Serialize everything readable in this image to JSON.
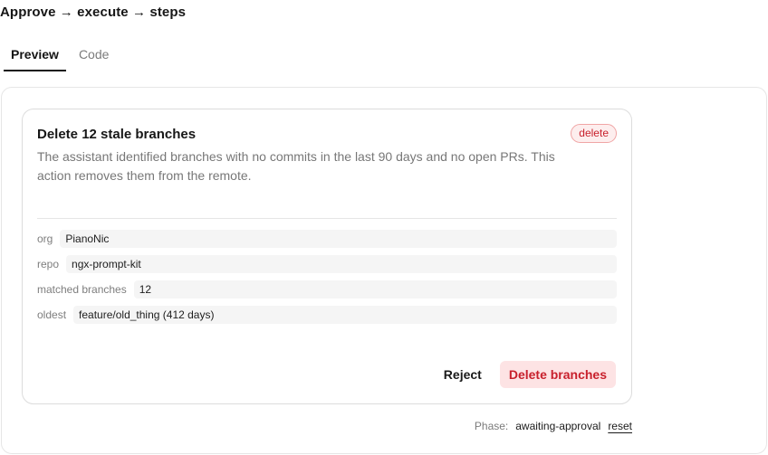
{
  "page": {
    "title": "Approve → execute → steps"
  },
  "tabs": [
    {
      "label": "Preview",
      "active": true
    },
    {
      "label": "Code",
      "active": false
    }
  ],
  "card": {
    "title": "Delete 12 stale branches",
    "badge": "delete",
    "description": "The assistant identified branches with no commits in the last 90 days and no open PRs. This action removes them from the remote.",
    "params": [
      {
        "key": "org",
        "value": "PianoNic"
      },
      {
        "key": "repo",
        "value": "ngx-prompt-kit"
      },
      {
        "key": "matched branches",
        "value": "12"
      },
      {
        "key": "oldest",
        "value": "feature/old_thing (412 days)"
      }
    ],
    "reject_label": "Reject",
    "confirm_label": "Delete branches"
  },
  "status": {
    "label": "Phase:",
    "value": "awaiting-approval",
    "reset_label": "reset"
  },
  "colors": {
    "danger": "#c8202c",
    "danger_bg": "#fde3e4",
    "badge_border": "#f0a5a5",
    "muted": "#777777"
  }
}
